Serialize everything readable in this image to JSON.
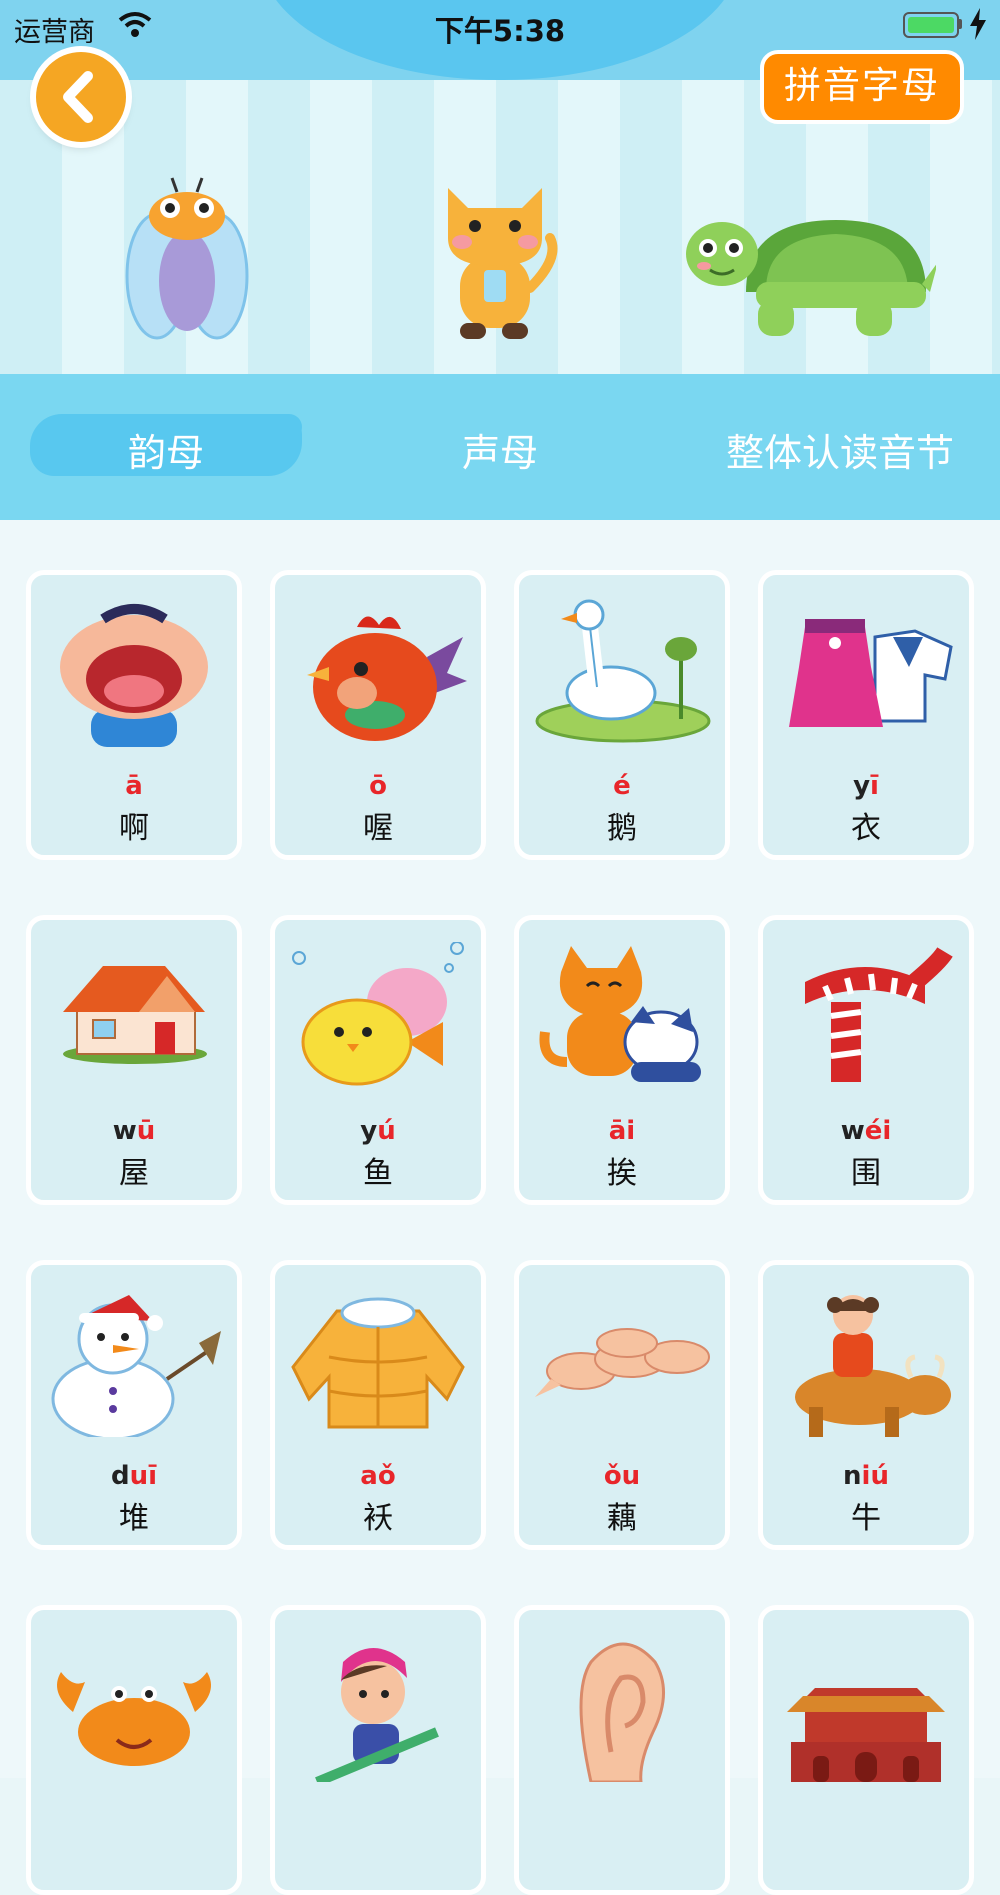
{
  "status_bar": {
    "carrier": "运营商",
    "time": "下午5:38"
  },
  "header": {
    "pinyin_button": "拼音字母"
  },
  "tabs": [
    {
      "label": "韵母",
      "active": true
    },
    {
      "label": "声母",
      "active": false
    },
    {
      "label": "整体认读音节",
      "active": false
    }
  ],
  "cards": [
    {
      "pinyin_parts": [
        "",
        "ā",
        ""
      ],
      "hanzi": "啊",
      "icon": "open-mouth-boy-icon"
    },
    {
      "pinyin_parts": [
        "",
        "ō",
        ""
      ],
      "hanzi": "喔",
      "icon": "rooster-icon"
    },
    {
      "pinyin_parts": [
        "",
        "é",
        ""
      ],
      "hanzi": "鹅",
      "icon": "goose-icon"
    },
    {
      "pinyin_parts": [
        "y",
        "ī",
        ""
      ],
      "hanzi": "衣",
      "icon": "clothes-icon"
    },
    {
      "pinyin_parts": [
        "w",
        "ū",
        ""
      ],
      "hanzi": "屋",
      "icon": "house-icon"
    },
    {
      "pinyin_parts": [
        "y",
        "ú",
        ""
      ],
      "hanzi": "鱼",
      "icon": "fish-icon"
    },
    {
      "pinyin_parts": [
        "",
        "āi",
        ""
      ],
      "hanzi": "挨",
      "icon": "cat-and-dog-icon"
    },
    {
      "pinyin_parts": [
        "w",
        "éi",
        ""
      ],
      "hanzi": "围",
      "icon": "scarf-icon"
    },
    {
      "pinyin_parts": [
        "d",
        "uī",
        ""
      ],
      "hanzi": "堆",
      "icon": "snowman-icon"
    },
    {
      "pinyin_parts": [
        "",
        "aǒ",
        ""
      ],
      "hanzi": "袄",
      "icon": "padded-jacket-icon"
    },
    {
      "pinyin_parts": [
        "",
        "ǒu",
        ""
      ],
      "hanzi": "藕",
      "icon": "lotus-root-icon"
    },
    {
      "pinyin_parts": [
        "n",
        "iú",
        ""
      ],
      "hanzi": "牛",
      "icon": "girl-on-ox-icon"
    },
    {
      "pinyin_parts": [
        "",
        "",
        ""
      ],
      "hanzi": "",
      "icon": "crab-icon"
    },
    {
      "pinyin_parts": [
        "",
        "",
        ""
      ],
      "hanzi": "",
      "icon": "skier-boy-icon"
    },
    {
      "pinyin_parts": [
        "",
        "",
        ""
      ],
      "hanzi": "",
      "icon": "ear-icon"
    },
    {
      "pinyin_parts": [
        "",
        "",
        ""
      ],
      "hanzi": "",
      "icon": "tiananmen-icon"
    }
  ],
  "colors": {
    "tab_bar": "#7ad7f1",
    "accent_orange": "#ff8a00",
    "tone_red": "#e8262a",
    "card_bg": "#d9eff3"
  }
}
